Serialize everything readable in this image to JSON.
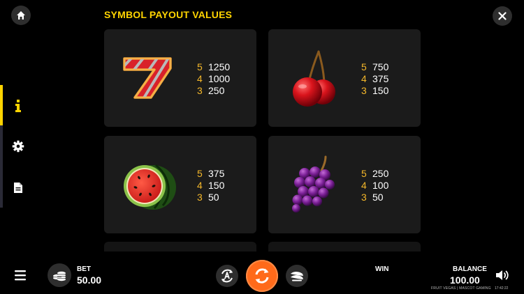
{
  "title": "SYMBOL PAYOUT VALUES",
  "icons": {
    "home": "home-icon",
    "close": "close-icon",
    "info": "info-icon",
    "settings": "gear-icon",
    "rules": "document-icon",
    "menu": "hamburger-icon",
    "bet": "chips-icon",
    "autoplay": "autoplay-icon",
    "spin": "spin-icon",
    "turbo": "turbo-icon",
    "sound": "speaker-icon"
  },
  "colors": {
    "accent": "#ffd400",
    "payout_count": "#f4b72a",
    "spin": "#ff6a1a",
    "card": "#1b1b1b"
  },
  "symbols": [
    {
      "name": "seven-symbol",
      "payouts": [
        {
          "count": "5",
          "value": "1250"
        },
        {
          "count": "4",
          "value": "1000"
        },
        {
          "count": "3",
          "value": "250"
        }
      ]
    },
    {
      "name": "cherry-symbol",
      "payouts": [
        {
          "count": "5",
          "value": "750"
        },
        {
          "count": "4",
          "value": "375"
        },
        {
          "count": "3",
          "value": "150"
        }
      ]
    },
    {
      "name": "watermelon-symbol",
      "payouts": [
        {
          "count": "5",
          "value": "375"
        },
        {
          "count": "4",
          "value": "150"
        },
        {
          "count": "3",
          "value": "50"
        }
      ]
    },
    {
      "name": "grapes-symbol",
      "payouts": [
        {
          "count": "5",
          "value": "250"
        },
        {
          "count": "4",
          "value": "100"
        },
        {
          "count": "3",
          "value": "50"
        }
      ]
    }
  ],
  "bottom_bar": {
    "bet_label": "BET",
    "bet_value": "50.00",
    "win_label": "WIN",
    "balance_label": "BALANCE",
    "balance_value": "100.00",
    "footer_note": "FRUIT VEGAS | MASCOT GAMING",
    "clock": "17:42:22"
  }
}
